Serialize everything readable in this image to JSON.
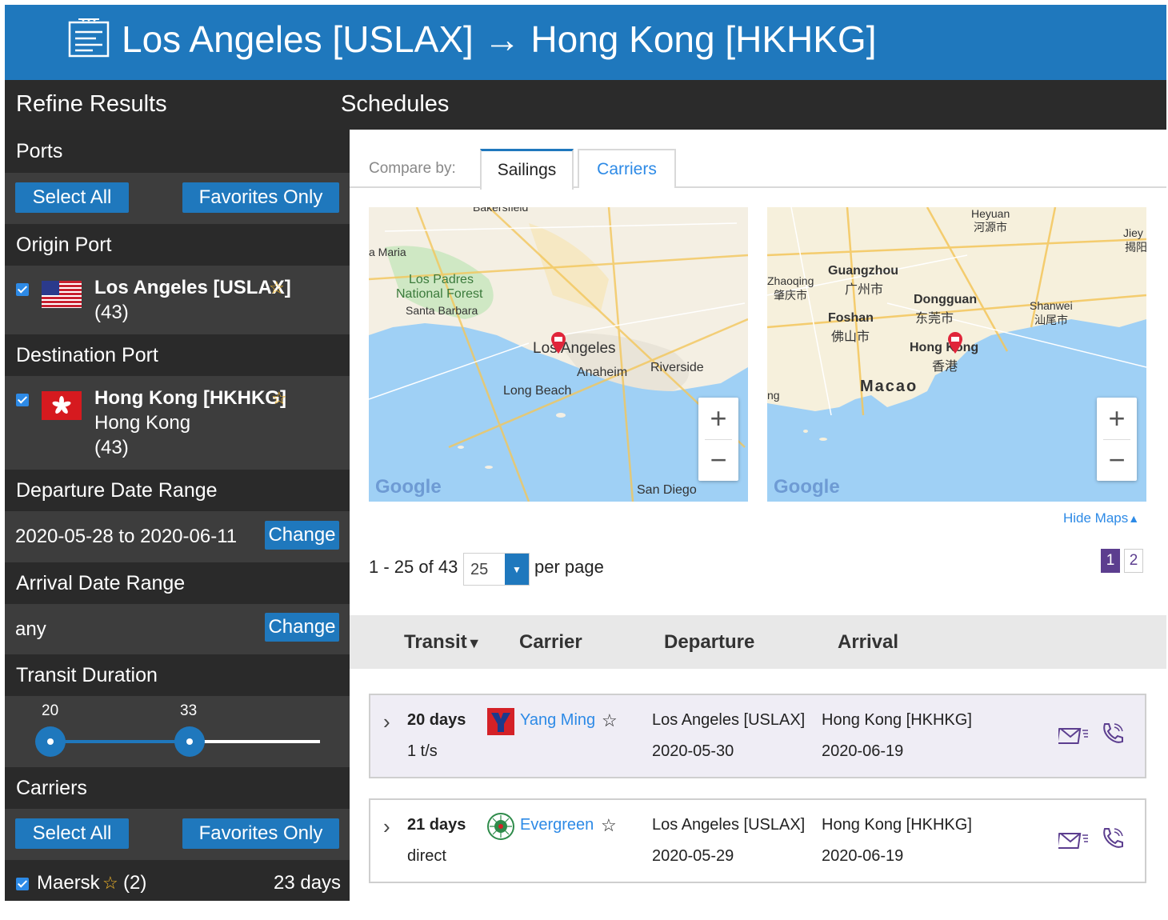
{
  "header": {
    "title": "Los Angeles [USLAX] → Hong Kong [HKHKG]"
  },
  "subheader": {
    "left": "Refine Results",
    "right": "Schedules"
  },
  "sidebar": {
    "ports": {
      "heading": "Ports",
      "select_all": "Select All",
      "favorites_only": "Favorites Only"
    },
    "origin": {
      "heading": "Origin Port",
      "name": "Los Angeles [USLAX]",
      "count": "(43)",
      "checked": true
    },
    "destination": {
      "heading": "Destination Port",
      "name": "Hong Kong [HKHKG]",
      "city": "Hong Kong",
      "count": "(43)",
      "checked": true
    },
    "departure": {
      "heading": "Departure Date Range",
      "value": "2020-05-28 to 2020-06-11",
      "change": "Change"
    },
    "arrival": {
      "heading": "Arrival Date Range",
      "value": "any",
      "change": "Change"
    },
    "transit": {
      "heading": "Transit Duration",
      "min": "20",
      "max": "33"
    },
    "carriers": {
      "heading": "Carriers",
      "select_all": "Select All",
      "favorites_only": "Favorites Only",
      "items": [
        {
          "name": "Maersk",
          "count": "(2)",
          "days": "23 days",
          "checked": true
        }
      ]
    }
  },
  "compare": {
    "label": "Compare by:",
    "tabs": [
      "Sailings",
      "Carriers"
    ],
    "active": 0
  },
  "maps": {
    "left": {
      "labels": [
        "Bakersfield",
        "a Maria",
        "Los Padres",
        "National Forest",
        "Santa Barbara",
        "Los Angeles",
        "Anaheim",
        "Riverside",
        "Long Beach",
        "San Diego"
      ]
    },
    "right": {
      "labels": [
        "Heyuan",
        "河源市",
        "Jiey",
        "揭阳",
        "Guangzhou",
        "广州市",
        "Zhaoqing",
        "肇庆市",
        "Dongguan",
        "东莞市",
        "Foshan",
        "佛山市",
        "Shanwei",
        "汕尾市",
        "Hong Kong",
        "香港",
        "Macao",
        "ng"
      ]
    },
    "google": "Google",
    "hide_maps": "Hide Maps"
  },
  "pagination": {
    "range": "1 - 25 of 43",
    "per_page_value": "25",
    "per_page_label": "per page",
    "pages": [
      "1",
      "2"
    ],
    "current": "1"
  },
  "table": {
    "columns": [
      "Transit",
      "Carrier",
      "Departure",
      "Arrival"
    ],
    "rows": [
      {
        "transit": "20 days",
        "stops": "1 t/s",
        "carrier": "Yang Ming",
        "departure_port": "Los Angeles [USLAX]",
        "departure_date": "2020-05-30",
        "arrival_port": "Hong Kong [HKHKG]",
        "arrival_date": "2020-06-19",
        "selected": true
      },
      {
        "transit": "21 days",
        "stops": "direct",
        "carrier": "Evergreen",
        "departure_port": "Los Angeles [USLAX]",
        "departure_date": "2020-05-29",
        "arrival_port": "Hong Kong [HKHKG]",
        "arrival_date": "2020-06-19",
        "selected": false
      }
    ]
  },
  "colors": {
    "primary_blue": "#1f78bd",
    "dark": "#2a2a2a",
    "panel": "#3d3d3d",
    "link": "#2d8ae6",
    "purple": "#5c3e8f",
    "star": "#f0b428"
  }
}
